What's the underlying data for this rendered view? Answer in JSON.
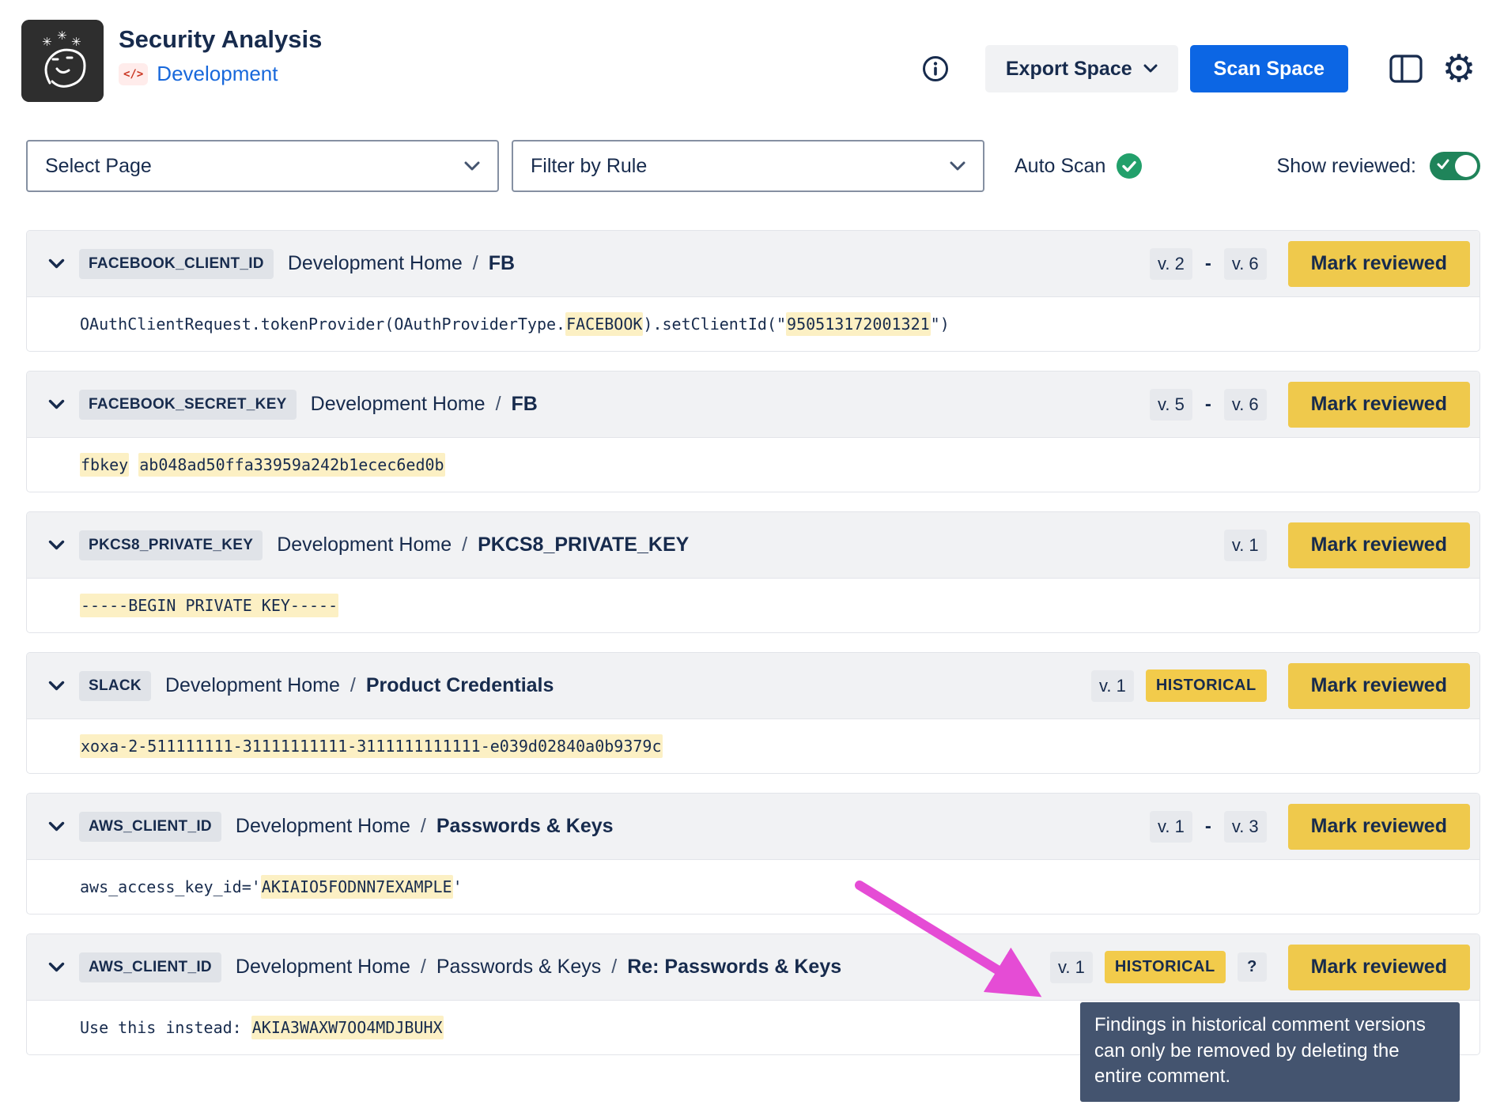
{
  "header": {
    "title": "Security Analysis",
    "space_type_icon": "</>",
    "space_name": "Development",
    "export_label": "Export Space",
    "scan_label": "Scan Space"
  },
  "filters": {
    "select_page": "Select Page",
    "filter_by_rule": "Filter by Rule",
    "auto_scan": "Auto Scan",
    "show_reviewed": "Show reviewed:"
  },
  "labels": {
    "mark_reviewed": "Mark reviewed",
    "historical": "HISTORICAL",
    "help": "?",
    "version_separator": "-",
    "breadcrumb_separator": "/"
  },
  "tooltip": {
    "text": "Findings in historical comment versions can only be removed by deleting the entire comment."
  },
  "icons": {
    "gear": "⚙",
    "info": "i",
    "check": "✓",
    "chevron_down": "⌄",
    "panel_layout": "window-with-left-panel",
    "logo": "doodle-face-with-asterisks"
  },
  "colors": {
    "text": "#172B4D",
    "muted": "#44546F",
    "link_blue": "#1868DB",
    "primary_blue": "#0C66E4",
    "subtle_btn": "#F1F2F4",
    "head_bg": "#F1F2F4",
    "border": "#E2E4E9",
    "rule_badge_bg": "#E0E3E8",
    "vbadge_bg": "#E7E9ED",
    "yellow": "#EFC94C",
    "yellow_badge": "#F2CB4B",
    "highlight": "#FCF0C4",
    "green": "#1F845A",
    "green_check": "#22A06B",
    "select_border": "#8590A2",
    "tooltip_bg": "#44546F",
    "arrow_pink": "#E54CD5",
    "logo_bg": "#2E2E2E",
    "code_chip_bg": "#FFECEB",
    "code_chip_text": "#CA3521"
  },
  "findings": [
    {
      "rule": "FACEBOOK_CLIENT_ID",
      "breadcrumbs": [
        "Development Home",
        "FB"
      ],
      "versions": [
        "v. 2",
        "v. 6"
      ],
      "historical": false,
      "help": false,
      "code": [
        {
          "t": "OAuthClientRequest.tokenProvider(OAuthProviderType.",
          "h": false
        },
        {
          "t": "FACEBOOK",
          "h": true
        },
        {
          "t": ").setClientId(\"",
          "h": false
        },
        {
          "t": "950513172001321",
          "h": true
        },
        {
          "t": "\")",
          "h": false
        }
      ]
    },
    {
      "rule": "FACEBOOK_SECRET_KEY",
      "breadcrumbs": [
        "Development Home",
        "FB"
      ],
      "versions": [
        "v. 5",
        "v. 6"
      ],
      "historical": false,
      "help": false,
      "code": [
        {
          "t": "fbkey",
          "h": true
        },
        {
          "t": " ",
          "h": false
        },
        {
          "t": "ab048ad50ffa33959a242b1ecec6ed0b",
          "h": true
        }
      ]
    },
    {
      "rule": "PKCS8_PRIVATE_KEY",
      "breadcrumbs": [
        "Development Home",
        "PKCS8_PRIVATE_KEY"
      ],
      "versions": [
        "v. 1"
      ],
      "historical": false,
      "help": false,
      "code": [
        {
          "t": "-----BEGIN PRIVATE KEY-----",
          "h": true
        }
      ]
    },
    {
      "rule": "SLACK",
      "breadcrumbs": [
        "Development Home",
        "Product Credentials"
      ],
      "versions": [
        "v. 1"
      ],
      "historical": true,
      "help": false,
      "code": [
        {
          "t": "xoxa-2-511111111-31111111111-3111111111111-e039d02840a0b9379c",
          "h": true
        }
      ]
    },
    {
      "rule": "AWS_CLIENT_ID",
      "breadcrumbs": [
        "Development Home",
        "Passwords & Keys"
      ],
      "versions": [
        "v. 1",
        "v. 3"
      ],
      "historical": false,
      "help": false,
      "code": [
        {
          "t": "aws_access_key_id='",
          "h": false
        },
        {
          "t": "AKIAIO5FODNN7EXAMPLE",
          "h": true
        },
        {
          "t": "'",
          "h": false
        }
      ]
    },
    {
      "rule": "AWS_CLIENT_ID",
      "breadcrumbs": [
        "Development Home",
        "Passwords & Keys",
        "Re: Passwords & Keys"
      ],
      "versions": [
        "v. 1"
      ],
      "historical": true,
      "help": true,
      "code": [
        {
          "t": "Use this instead: ",
          "h": false
        },
        {
          "t": "AKIA3WAXW7OO4MDJBUHX",
          "h": true
        }
      ]
    }
  ]
}
